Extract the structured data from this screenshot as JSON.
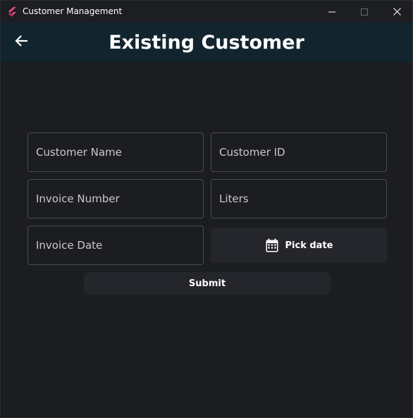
{
  "window": {
    "title": "Customer Management",
    "app_icon": "flutter-logo-icon",
    "controls": [
      "minimize-icon",
      "maximize-icon",
      "close-icon"
    ]
  },
  "appbar": {
    "back_icon": "arrow-left-icon",
    "title": "Existing Customer",
    "background": "#12252f"
  },
  "form": {
    "customer_name": {
      "placeholder": "Customer Name",
      "value": ""
    },
    "customer_id": {
      "placeholder": "Customer ID",
      "value": ""
    },
    "invoice_number": {
      "placeholder": "Invoice Number",
      "value": ""
    },
    "liters": {
      "placeholder": "Liters",
      "value": ""
    },
    "invoice_date": {
      "placeholder": "Invoice Date",
      "value": ""
    },
    "pick_date": {
      "label": "Pick date",
      "icon": "calendar-icon"
    },
    "submit": {
      "label": "Submit"
    }
  },
  "colors": {
    "background": "#1c1d20",
    "button": "#25262b",
    "field_border": "#4a4b4f",
    "text": "#ffffff"
  }
}
